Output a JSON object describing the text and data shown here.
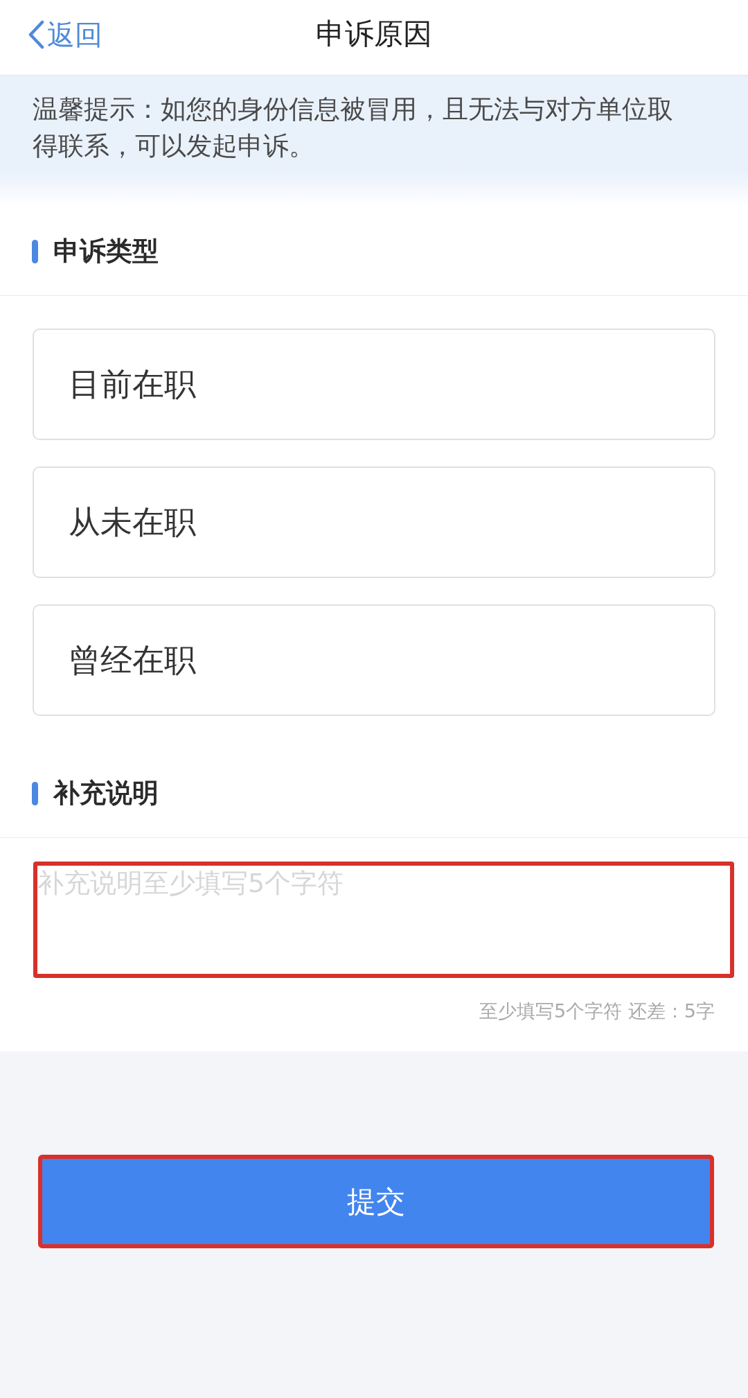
{
  "header": {
    "back": {
      "label": "返回"
    },
    "title": "申诉原因"
  },
  "notice": "温馨提示：如您的身份信息被冒用，且无法与对方单位取得联系，可以发起申诉。",
  "sections": [
    {
      "kind": "choice",
      "heading": "申诉类型",
      "options": [
        {
          "label": "目前在职",
          "selected": false
        },
        {
          "label": "从未在职",
          "selected": false
        },
        {
          "label": "曾经在职",
          "selected": false
        }
      ]
    },
    {
      "kind": "text",
      "heading": "补充说明",
      "field": {
        "placeholder": "补充说明至少填写5个字符",
        "highlighted": true
      },
      "counter": "至少填写5个字符 还差：5字"
    }
  ],
  "submit": {
    "label": "提交",
    "highlighted": true
  }
}
